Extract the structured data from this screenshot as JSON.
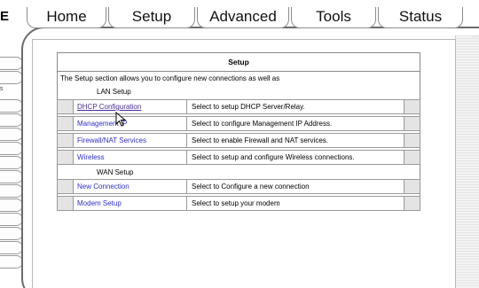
{
  "brand_stub": "E",
  "left_edge_letters": "s",
  "nav": {
    "tabs": [
      {
        "label": "Home"
      },
      {
        "label": "Setup"
      },
      {
        "label": "Advanced"
      },
      {
        "label": "Tools"
      },
      {
        "label": "Status"
      }
    ]
  },
  "setup": {
    "title": "Setup",
    "intro": "The Setup section allows you to configure new connections as well as",
    "lan_heading": "LAN Setup",
    "wan_heading": "WAN Setup",
    "lan_rows": [
      {
        "link": "DHCP Configuration",
        "desc": "Select to setup DHCP Server/Relay."
      },
      {
        "link": "Management IP",
        "desc": "Select to configure Management IP Address."
      },
      {
        "link": "Firewall/NAT Services",
        "desc": "Select to enable Firewall and NAT services."
      },
      {
        "link": "Wireless",
        "desc": "Select to setup and configure Wireless connections."
      }
    ],
    "wan_rows": [
      {
        "link": "New Connection",
        "desc": "Select to Configure a new connection"
      },
      {
        "link": "Modem Setup",
        "desc": "Select to setup your modem"
      }
    ]
  }
}
